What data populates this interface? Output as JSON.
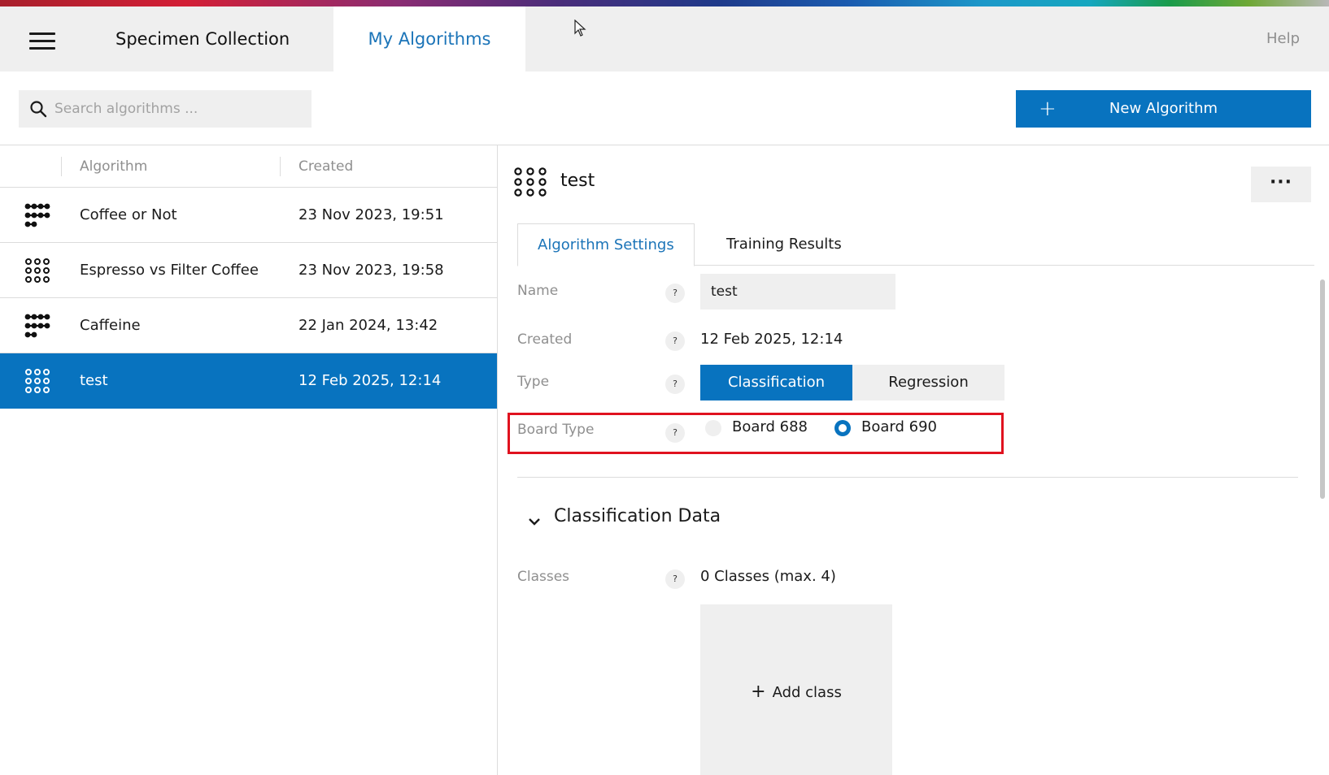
{
  "topbar": {
    "specimen_label": "Specimen Collection",
    "algorithms_label": "My Algorithms",
    "help_label": "Help"
  },
  "search": {
    "placeholder": "Search algorithms ..."
  },
  "new_button": {
    "label": "New Algorithm"
  },
  "list": {
    "headers": {
      "algorithm": "Algorithm",
      "created": "Created"
    },
    "rows": [
      {
        "icon": "dense-network-icon",
        "name": "Coffee or Not",
        "date": "23 Nov 2023, 19:51"
      },
      {
        "icon": "dot-grid-icon",
        "name": "Espresso vs Filter Coffee",
        "date": "23 Nov 2023, 19:58"
      },
      {
        "icon": "dense-network-icon",
        "name": "Caffeine",
        "date": "22 Jan 2024, 13:42"
      },
      {
        "icon": "dot-grid-icon",
        "name": "test",
        "date": "12 Feb 2025, 12:14",
        "selected": true
      }
    ]
  },
  "detail": {
    "title": "test",
    "more_label": "···",
    "tabs": [
      "Algorithm Settings",
      "Training Results"
    ],
    "fields": {
      "name_label": "Name",
      "name_value": "test",
      "created_label": "Created",
      "created_value": "12 Feb 2025, 12:14",
      "type_label": "Type",
      "type_options": [
        "Classification",
        "Regression"
      ],
      "type_selected": "Classification",
      "board_label": "Board Type",
      "board_options": [
        "Board 688",
        "Board 690"
      ],
      "board_selected": "Board 690"
    },
    "help_mark": "?",
    "section_title": "Classification Data",
    "classes_label": "Classes",
    "classes_value": "0 Classes (max. 4)",
    "add_class_label": "Add class"
  },
  "colors": {
    "accent": "#0873bf",
    "highlight": "#e0121f",
    "panel": "#efefef"
  }
}
